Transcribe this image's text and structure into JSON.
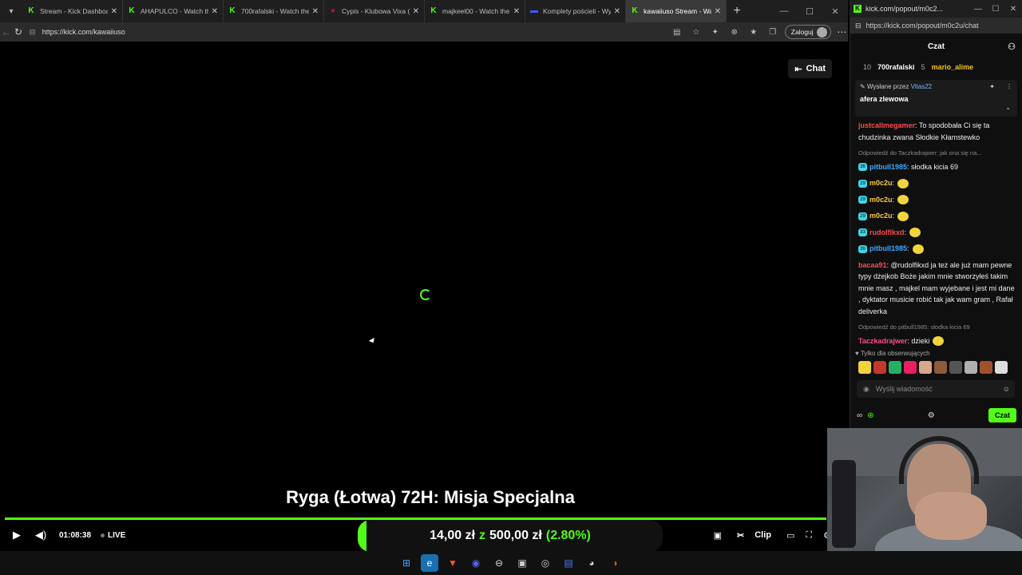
{
  "main_window": {
    "tabs": [
      {
        "title": "Stream - Kick Dashboard",
        "favicon": "kick-icon",
        "color": "#53fc18",
        "active": false
      },
      {
        "title": "AHAPULCO - Watch the",
        "favicon": "kick-icon",
        "color": "#53fc18",
        "active": false
      },
      {
        "title": "700rafalski - Watch the",
        "favicon": "kick-icon",
        "color": "#53fc18",
        "active": false
      },
      {
        "title": "Cypis - Klubowa Vixa (Kr",
        "favicon": "music-icon",
        "color": "#b3123d",
        "active": false
      },
      {
        "title": "majkeel00 - Watch the",
        "favicon": "kick-icon",
        "color": "#53fc18",
        "active": false
      },
      {
        "title": "Komplety pościeli - Wyg",
        "favicon": "shop-icon",
        "color": "#3d5af1",
        "active": false
      },
      {
        "title": "kawaiiuso Stream - Watc",
        "favicon": "kick-icon",
        "color": "#53fc18",
        "active": true
      }
    ],
    "url": "https://kick.com/kawaiiuso",
    "login_label": "Zaloguj"
  },
  "player": {
    "chat_toggle_label": "Chat",
    "overlay_title": "Ryga (Łotwa) 72H: Misja Specjalna",
    "time": "01:08:38",
    "live_label": "LIVE",
    "clip_label": "Clip"
  },
  "goal": {
    "current": "14,00 zł",
    "separator": "z",
    "target": "500,00 zł",
    "percent_label": "(2.80%)",
    "progress_percent": 2.8,
    "accent": "#53fc18"
  },
  "chat_window": {
    "tab_title": "kick.com/popout/m0c2...",
    "url": "https://kick.com/popout/m0c2u/chat",
    "header_title": "Czat",
    "top_gifters": [
      {
        "rank": "10",
        "name": "700rafalski",
        "count": "5"
      },
      {
        "rank": "",
        "name": "mario_alime",
        "count": ""
      }
    ],
    "pinned": {
      "by_prefix": "Wysłane przez",
      "by_user": "Vitas22",
      "message": "afera zlewowa"
    },
    "messages": [
      {
        "user": "justcallmegamer",
        "color": "#ff4b4b",
        "badge": "",
        "text": ": To spodobała Ci się ta chudzinka zwana Słodkie Kłamstewko"
      },
      {
        "reply": "Odpowiedź do Taczkadrajwer: jak ona się na..."
      },
      {
        "user": "pitbull1985",
        "color": "#3fa9ff",
        "badge": "36",
        "text": ": słodka kicia 69"
      },
      {
        "user": "m0c2u",
        "color": "#f7c948",
        "badge": "29",
        "text": ":",
        "emote": true
      },
      {
        "user": "m0c2u",
        "color": "#f7c948",
        "badge": "29",
        "text": ":",
        "emote": true
      },
      {
        "user": "m0c2u",
        "color": "#f7c948",
        "badge": "29",
        "text": ":",
        "emote": true
      },
      {
        "user": "rudolfikxd",
        "color": "#ff4b4b",
        "badge": "33",
        "text": ":",
        "emote": true
      },
      {
        "user": "pitbull1985",
        "color": "#3fa9ff",
        "badge": "36",
        "text": ":",
        "emote": true
      },
      {
        "user": "bacaa91",
        "color": "#ff4b4b",
        "badge": "",
        "text": ": @rudolfikxd ja też ale już mam pewne typy dżejkob Boże jakim mnie stworzyłeś takim mnie masz , majkel mam wyjebane i jest mi dane , dyktator musicie robić tak jak wam gram , Rafał deliverka"
      },
      {
        "reply": "Odpowiedź do pitbull1985: słodka kicia 69"
      },
      {
        "user": "Taczkadrajwer",
        "color": "#ff4b8b",
        "badge": "",
        "text": ": dzieki",
        "emote": true
      }
    ],
    "followers_note": "Tylko dla obserwujących",
    "input_placeholder": "Wyślij wiadomość",
    "send_label": "Czat"
  }
}
